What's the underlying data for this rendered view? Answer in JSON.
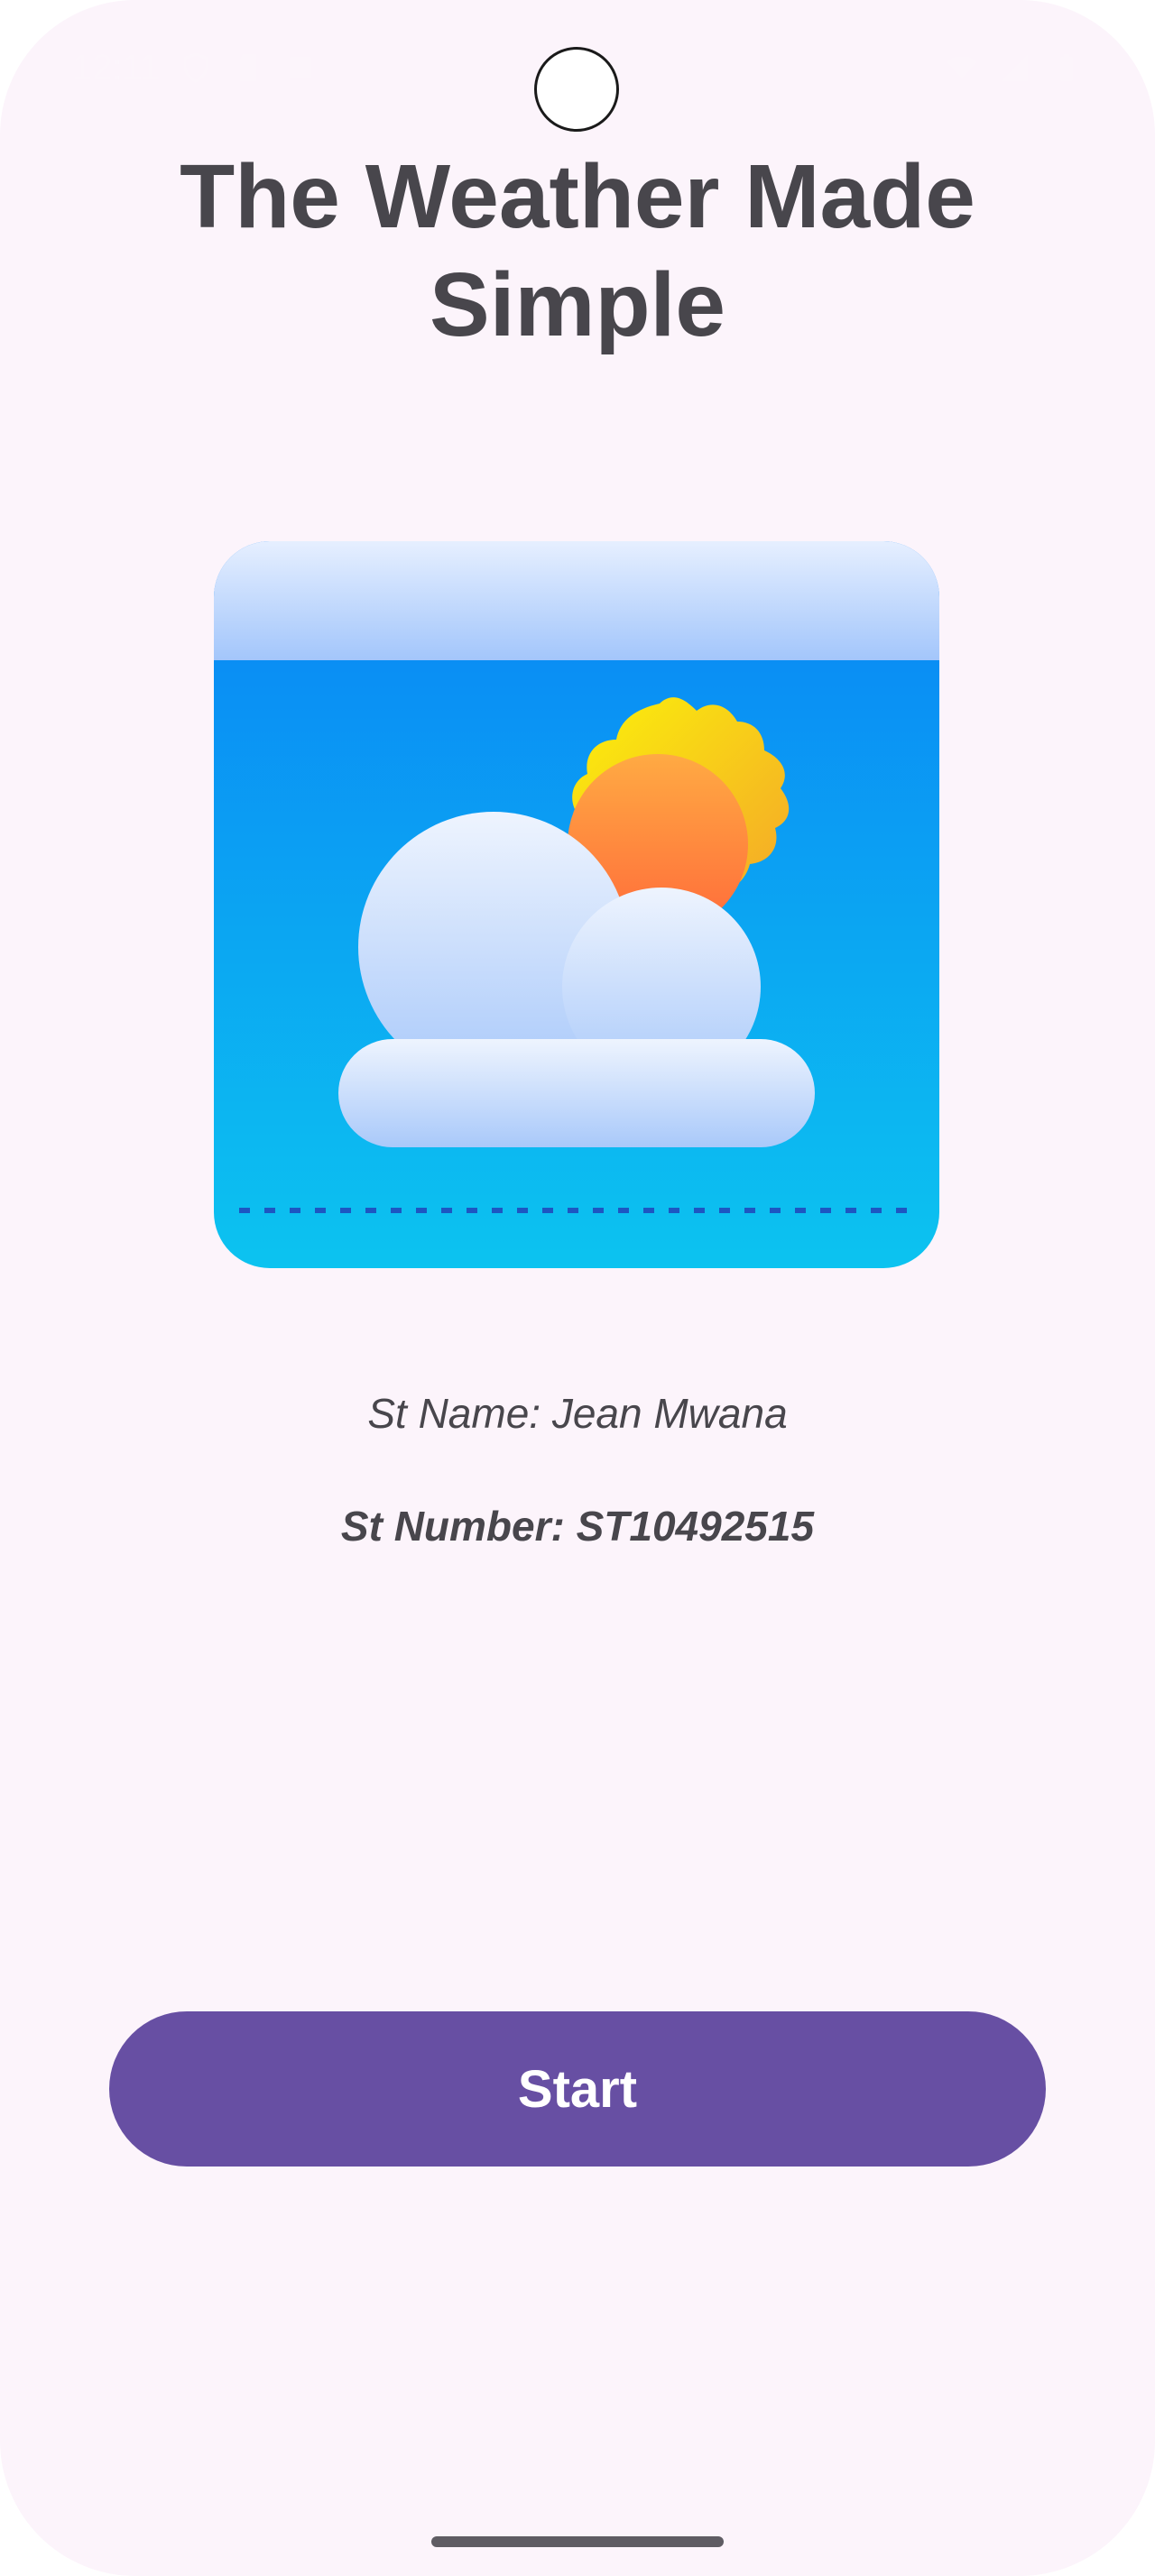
{
  "status_bar": {
    "time": "12:11",
    "icons": [
      "shield-icon",
      "sd-card-icon",
      "square-icon",
      "wifi-icon",
      "cellular-signal-icon",
      "battery-icon"
    ]
  },
  "app": {
    "title": "The Weather Made Simple",
    "hero_icon": "weather-partly-cloudy-icon",
    "student_name": "St Name: Jean Mwana",
    "student_number": "St Number: ST10492515",
    "start_label": "Start"
  },
  "colors": {
    "background": "#fcf4fb",
    "title_text": "#48464c",
    "button_primary": "#674fa3",
    "button_text": "#ffffff",
    "sky_top": "#0a84f5",
    "sky_bottom": "#0cc3f0",
    "sun_outer": "#f6d30c",
    "sun_inner": "#ff7a3c",
    "cloud": "#dbe8fb"
  }
}
